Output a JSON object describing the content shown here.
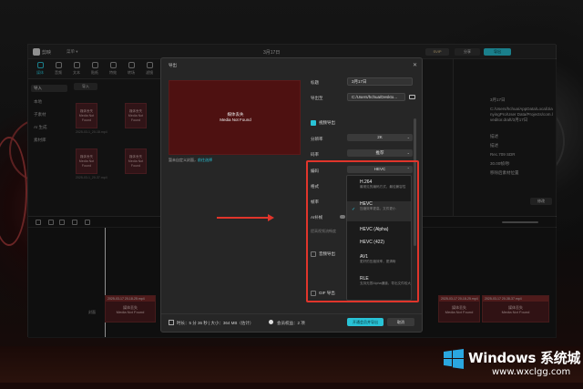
{
  "app": {
    "logo_text": "剪映",
    "menu": "菜单 ▾",
    "project_title": "3月17日",
    "svip": "SVIP",
    "share": "分享",
    "export": "导出",
    "tools": [
      {
        "label": "媒体",
        "icon": "media-icon"
      },
      {
        "label": "音频",
        "icon": "audio-icon"
      },
      {
        "label": "文本",
        "icon": "text-icon"
      },
      {
        "label": "贴纸",
        "icon": "sticker-icon"
      },
      {
        "label": "特效",
        "icon": "effects-icon"
      },
      {
        "label": "转场",
        "icon": "transition-icon"
      },
      {
        "label": "滤镜",
        "icon": "filter-icon"
      }
    ],
    "sidebar": [
      "导入",
      "本地",
      "子素材",
      "AI 生成",
      "素材库"
    ],
    "media_header": "导入",
    "thumbs": [
      {
        "tag": "已添加",
        "time": "01:48",
        "text": "媒体丢失\nMedia Not Found",
        "meta": "2025-03-1_20-18.mp4"
      },
      {
        "tag": "已添加",
        "time": "",
        "text": "媒体丢失\nMedia Not Found",
        "meta": "2025-03-1"
      },
      {
        "tag": "已添加",
        "time": "02:14",
        "text": "媒体丢失\nMedia Not Found",
        "meta": "2025-03-1_20-37.mp4"
      },
      {
        "tag": "已添加",
        "time": "",
        "text": "媒体丢失\nMedia Not Found",
        "meta": "2025-03-1"
      }
    ],
    "right_panel": {
      "rows": [
        {
          "label": "",
          "value": "3月17日"
        },
        {
          "label": "",
          "value": "C:/Users/hchua/AppData/Local/JianyingPro/User Data/Projects/com.lveditor.draft/3月17日"
        },
        {
          "label": "",
          "value": "描述"
        },
        {
          "label": "",
          "value": "描述"
        },
        {
          "label": "",
          "value": "Rec.709 SDR"
        },
        {
          "label": "",
          "value": "30.00帧/秒"
        },
        {
          "label": "",
          "value": "移除后素材位置"
        }
      ],
      "modify": "修改"
    },
    "timeline": {
      "clip1_head": "2025-03-17 20-18-25.mp4",
      "clip1_text": "媒体丢失\nMedia Not Found",
      "clip2_head": "2025-03-17 20-18-25.mp4",
      "clip2_text": "媒体丢失\nMedia Not Found",
      "clip3_head": "2025-03-17 20-38-37.mp4",
      "clip3_text": "媒体丢失\nMedia Not Found",
      "cover_label": "封面"
    }
  },
  "dialog": {
    "title": "导出",
    "preview_text": "媒体丢失\nMedia Not Found",
    "cover_edit": "暂未自定义封面，",
    "cover_link": "前往选择",
    "title_label": "标题",
    "title_value": "3月17日",
    "export_to_label": "导出至",
    "export_to_value": "C:/Users/hchua/Deskto...",
    "video_export": "视频导出",
    "resolution_label": "分辨率",
    "resolution_value": "2K",
    "bitrate_label": "码率",
    "bitrate_value": "推荐",
    "codec_label": "编码",
    "codec_value": "HEVC",
    "format_label": "格式",
    "fps_label": "帧率",
    "ai_label": "AI补帧",
    "ai_sub": "提高视频流畅度",
    "audio_export": "音频导出",
    "gif_export": "GIF 导出",
    "footer_duration": "时长：5 分 36 秒 | 大小：364 MB（估计）",
    "footer_member": "会员权益：2 项",
    "export_btn": "开通会员并导出",
    "cancel_btn": "取消",
    "codec_options": [
      {
        "name": "H.264",
        "desc": "最常见的编码方式，最佳兼容性",
        "selected": false
      },
      {
        "name": "HEVC",
        "desc": "压缩效率更高，文件更小",
        "selected": true
      },
      {
        "name": "HEVC (Alpha)",
        "desc": "",
        "selected": false
      },
      {
        "name": "HEVC (422)",
        "desc": "",
        "selected": false
      },
      {
        "name": "AV1",
        "desc": "更好的压缩效率，更清晰",
        "selected": false
      },
      {
        "name": "RLE",
        "desc": "支持无损Alpha通道，导出文件较大",
        "selected": false
      }
    ]
  },
  "watermark": {
    "title": "Windows 系统城",
    "url": "www.wxclgg.com"
  },
  "colors": {
    "accent": "#29c3d6",
    "highlight": "#e0352b",
    "clip": "#4b1d1f"
  }
}
